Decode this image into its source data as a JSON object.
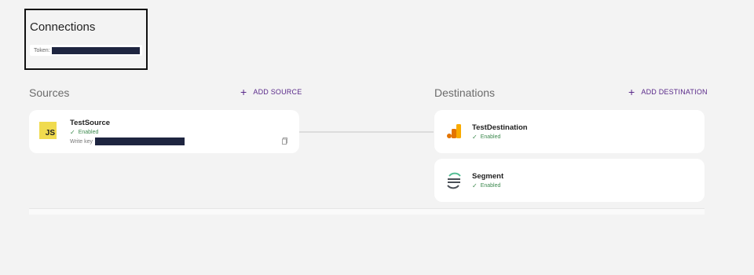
{
  "connections": {
    "title": "Connections",
    "token_label": "Token:"
  },
  "sources": {
    "title": "Sources",
    "add_label": "ADD SOURCE",
    "items": [
      {
        "name": "TestSource",
        "status": "Enabled",
        "write_key_label": "Write key",
        "icon": "javascript-icon"
      }
    ]
  },
  "destinations": {
    "title": "Destinations",
    "add_label": "ADD DESTINATION",
    "items": [
      {
        "name": "TestDestination",
        "status": "Enabled",
        "icon": "google-analytics-icon"
      },
      {
        "name": "Segment",
        "status": "Enabled",
        "icon": "segment-icon"
      }
    ]
  },
  "colors": {
    "accent": "#5a2a8a",
    "enabled": "#3d8a4f",
    "redaction": "#1e2540"
  }
}
